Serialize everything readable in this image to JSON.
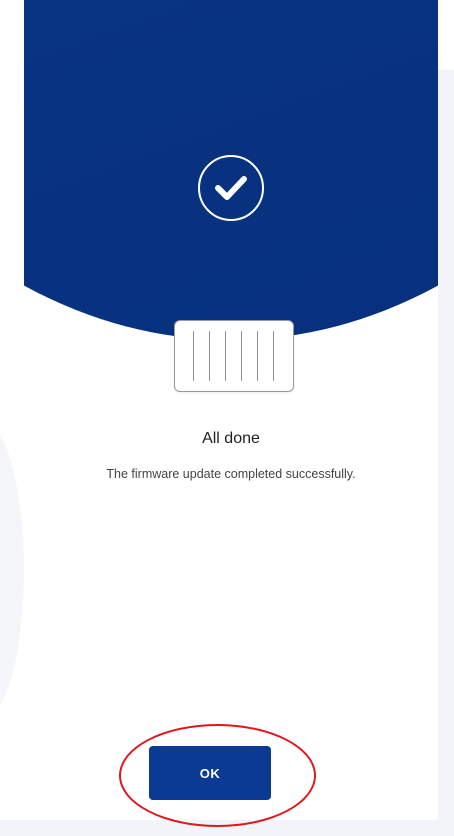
{
  "content": {
    "title": "All done",
    "message": "The firmware update completed successfully."
  },
  "actions": {
    "ok_label": "OK"
  },
  "icons": {
    "status": "checkmark-circle-icon",
    "device": "firmware-device-icon"
  },
  "colors": {
    "hero_blue": "#0a3584",
    "button_blue": "#0a3a93",
    "highlight_red": "#e0161c"
  }
}
